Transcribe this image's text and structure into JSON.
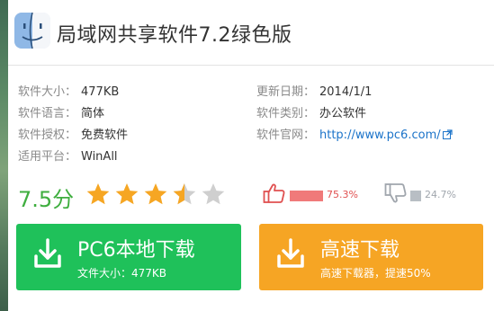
{
  "header": {
    "title": "局域网共享软件7.2绿色版",
    "icon": "finder-app-icon"
  },
  "info": {
    "size_label": "软件大小：",
    "size_value": "477KB",
    "update_label": "更新日期：",
    "update_value": "2014/1/1",
    "lang_label": "软件语言：",
    "lang_value": "简体",
    "category_label": "软件类别：",
    "category_value": "办公软件",
    "license_label": "软件授权：",
    "license_value": "免费软件",
    "site_label": "软件官网：",
    "site_value": "http://www.pc6.com/",
    "platform_label": "适用平台：",
    "platform_value": "WinAll"
  },
  "rating": {
    "score_text": "7.5分",
    "stars_out_of_5": 3.5,
    "up_percent_text": "75.3%",
    "down_percent_text": "24.7%",
    "up_fraction": 0.753,
    "down_fraction": 0.247,
    "colors": {
      "star_on": "#f6a623",
      "star_off": "#cfcfcf",
      "score": "#3fae3f"
    }
  },
  "downloads": {
    "local": {
      "label": "PC6本地下载",
      "sub": "文件大小：477KB",
      "color": "#1fc15a"
    },
    "fast": {
      "label": "高速下载",
      "sub": "高速下载器，提速50%",
      "color": "#f6a524"
    }
  }
}
